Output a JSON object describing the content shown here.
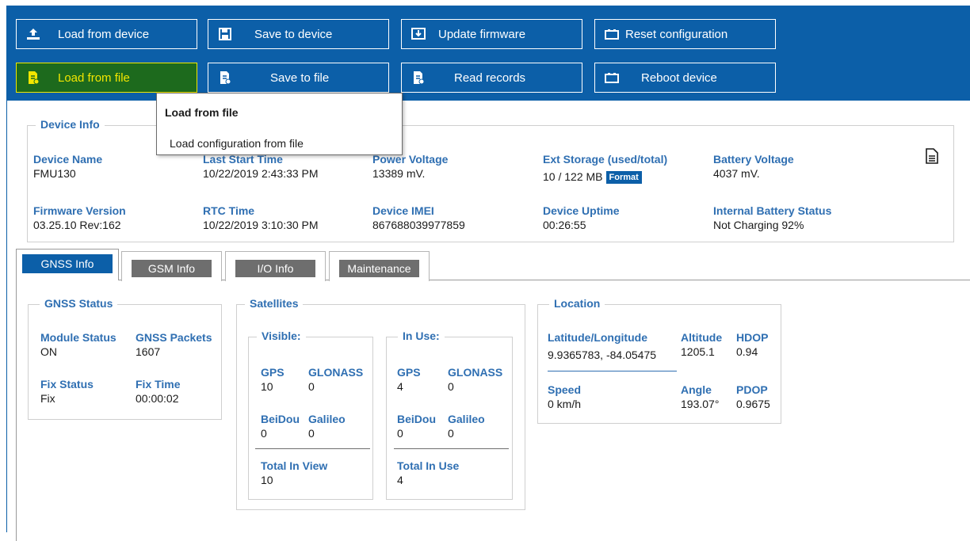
{
  "toolbar": {
    "row1": [
      {
        "label": "Load from device",
        "icon": "upload-icon"
      },
      {
        "label": "Save to device",
        "icon": "save-icon"
      },
      {
        "label": "Update firmware",
        "icon": "download-icon"
      },
      {
        "label": "Reset configuration",
        "icon": "battery-icon"
      }
    ],
    "row2": [
      {
        "label": "Load from file",
        "icon": "file-add-icon"
      },
      {
        "label": "Save to file",
        "icon": "file-check-icon"
      },
      {
        "label": "Read records",
        "icon": "file-check-icon"
      },
      {
        "label": "Reboot device",
        "icon": "battery-icon"
      }
    ],
    "active_color": "#1d6a1d",
    "bar_color": "#0c5fa8"
  },
  "tooltip": {
    "title": "Load from file",
    "body": "Load configuration from file"
  },
  "device_info": {
    "title": "Device Info",
    "device_name_label": "Device Name",
    "device_name": "FMU130",
    "last_start_label": "Last Start Time",
    "last_start": "10/22/2019 2:43:33 PM",
    "power_voltage_label": "Power Voltage",
    "power_voltage": "13389 mV.",
    "ext_storage_label": "Ext Storage (used/total)",
    "ext_storage": "10 / 122 MB",
    "format_label": "Format",
    "battery_voltage_label": "Battery Voltage",
    "battery_voltage": "4037 mV.",
    "firmware_label": "Firmware Version",
    "firmware": "03.25.10 Rev:162",
    "rtc_label": "RTC Time",
    "rtc": "10/22/2019 3:10:30 PM",
    "imei_label": "Device IMEI",
    "imei": "867688039977859",
    "uptime_label": "Device Uptime",
    "uptime": "00:26:55",
    "int_battery_label": "Internal Battery Status",
    "int_battery": "Not Charging 92%"
  },
  "tabs": [
    {
      "label": "GNSS Info",
      "selected": true
    },
    {
      "label": "GSM Info",
      "selected": false
    },
    {
      "label": "I/O Info",
      "selected": false
    },
    {
      "label": "Maintenance",
      "selected": false
    }
  ],
  "gnss_status": {
    "title": "GNSS Status",
    "module_status_label": "Module Status",
    "module_status": "ON",
    "gnss_packets_label": "GNSS Packets",
    "gnss_packets": "1607",
    "fix_status_label": "Fix Status",
    "fix_status": "Fix",
    "fix_time_label": "Fix Time",
    "fix_time": "00:00:02"
  },
  "satellites": {
    "title": "Satellites",
    "visible": {
      "title": "Visible:",
      "gps_label": "GPS",
      "gps": "10",
      "glonass_label": "GLONASS",
      "glonass": "0",
      "beidou_label": "BeiDou",
      "beidou": "0",
      "galileo_label": "Galileo",
      "galileo": "0",
      "total_label": "Total In View",
      "total": "10"
    },
    "in_use": {
      "title": "In Use:",
      "gps_label": "GPS",
      "gps": "4",
      "glonass_label": "GLONASS",
      "glonass": "0",
      "beidou_label": "BeiDou",
      "beidou": "0",
      "galileo_label": "Galileo",
      "galileo": "0",
      "total_label": "Total In Use",
      "total": "4"
    }
  },
  "location": {
    "title": "Location",
    "latlon_label": "Latitude/Longitude",
    "latlon": "9.9365783, -84.05475",
    "altitude_label": "Altitude",
    "altitude": "1205.1",
    "hdop_label": "HDOP",
    "hdop": "0.94",
    "speed_label": "Speed",
    "speed": "0 km/h",
    "angle_label": "Angle",
    "angle": "193.07°",
    "pdop_label": "PDOP",
    "pdop": "0.9675"
  }
}
